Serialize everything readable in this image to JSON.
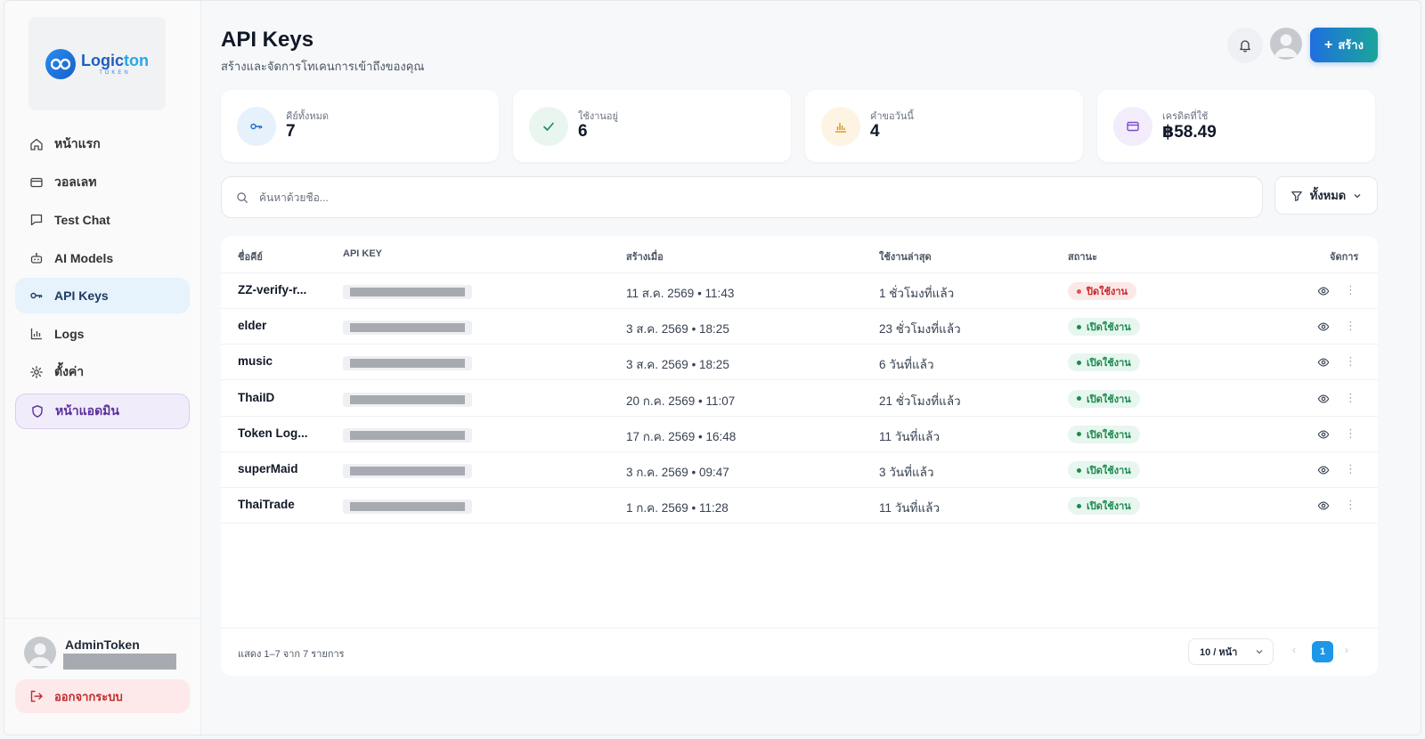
{
  "brand": {
    "name_a": "Logic",
    "name_b": "ton",
    "sub": "TOKEN"
  },
  "sidebar": {
    "items": [
      {
        "label": "หน้าแรก"
      },
      {
        "label": "วอลเลท"
      },
      {
        "label": "Test Chat"
      },
      {
        "label": "AI Models"
      },
      {
        "label": "API Keys",
        "active": true
      },
      {
        "label": "Logs"
      },
      {
        "label": "ตั้งค่า"
      },
      {
        "label": "หน้าแอดมิน"
      }
    ],
    "user": {
      "name": "AdminToken"
    },
    "logout_label": "ออกจากระบบ"
  },
  "header": {
    "title": "API Keys",
    "subtitle": "สร้างและจัดการโทเคนการเข้าถึงของคุณ",
    "create_label": "สร้าง"
  },
  "stats": [
    {
      "label": "คีย์ทั้งหมด",
      "value": "7",
      "icon": "key-icon",
      "bg": "#e6f1fb",
      "color": "#1e6fc8"
    },
    {
      "label": "ใช้งานอยู่",
      "value": "6",
      "icon": "check-icon",
      "bg": "#e8f6ef",
      "color": "#1b8a4d"
    },
    {
      "label": "คำขอวันนี้",
      "value": "4",
      "icon": "chart-icon",
      "bg": "#fdf4e3",
      "color": "#d9961c"
    },
    {
      "label": "เครดิตที่ใช้",
      "value": "฿58.49",
      "icon": "wallet-icon",
      "bg": "#f2ecfb",
      "color": "#7c4fc4"
    }
  ],
  "search": {
    "placeholder": "ค้นหาด้วยชื่อ..."
  },
  "filter": {
    "label": "ทั้งหมด"
  },
  "table": {
    "headers": {
      "name": "ชื่อคีย์",
      "key": "API KEY",
      "created": "สร้างเมื่อ",
      "last_used": "ใช้งานล่าสุด",
      "status": "สถานะ",
      "actions": "จัดการ"
    },
    "rows": [
      {
        "name": "ZZ-verify-r...",
        "created": "11 ส.ค. 2569 • 11:43",
        "last_used": "1 ชั่วโมงที่แล้ว",
        "status": "ปิดใช้งาน",
        "active": false
      },
      {
        "name": "elder",
        "created": "3 ส.ค. 2569 • 18:25",
        "last_used": "23 ชั่วโมงที่แล้ว",
        "status": "เปิดใช้งาน",
        "active": true
      },
      {
        "name": "music",
        "created": "3 ส.ค. 2569 • 18:25",
        "last_used": "6 วันที่แล้ว",
        "status": "เปิดใช้งาน",
        "active": true
      },
      {
        "name": "ThaiID",
        "created": "20 ก.ค. 2569 • 11:07",
        "last_used": "21 ชั่วโมงที่แล้ว",
        "status": "เปิดใช้งาน",
        "active": true
      },
      {
        "name": "Token Log...",
        "created": "17 ก.ค. 2569 • 16:48",
        "last_used": "11 วันที่แล้ว",
        "status": "เปิดใช้งาน",
        "active": true
      },
      {
        "name": "superMaid",
        "created": "3 ก.ค. 2569 • 09:47",
        "last_used": "3 วันที่แล้ว",
        "status": "เปิดใช้งาน",
        "active": true
      },
      {
        "name": "ThaiTrade",
        "created": "1 ก.ค. 2569 • 11:28",
        "last_used": "11 วันที่แล้ว",
        "status": "เปิดใช้งาน",
        "active": true
      }
    ]
  },
  "footer": {
    "summary": "แสดง 1–7 จาก 7 รายการ",
    "page_size": "10 / หน้า",
    "current_page": "1",
    "prev": "‹",
    "next": "›"
  }
}
